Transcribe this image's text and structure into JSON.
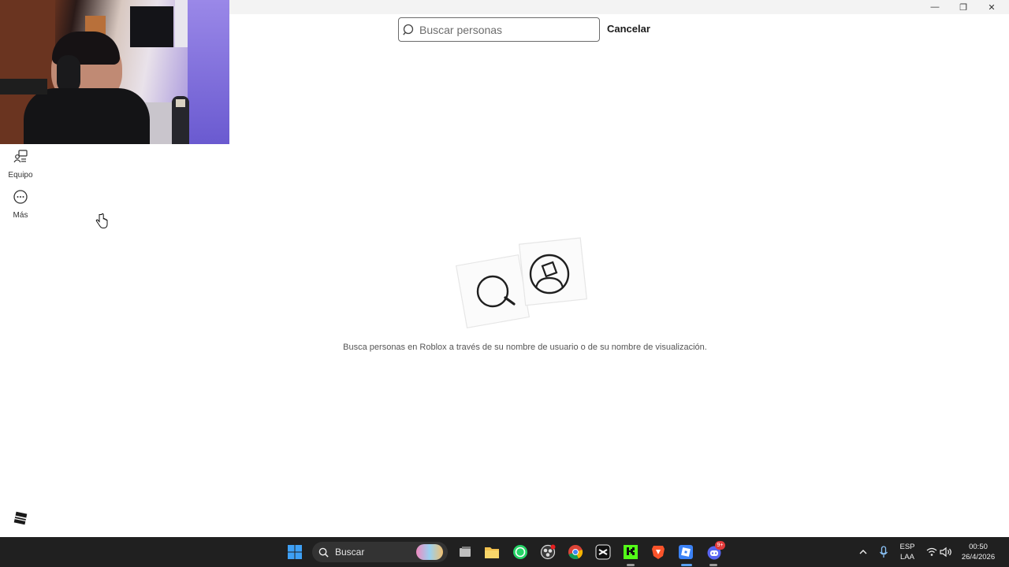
{
  "window": {
    "minimize": "—",
    "maximize": "❐",
    "close": "✕"
  },
  "search": {
    "placeholder": "Buscar personas",
    "value": "",
    "cancel_label": "Cancelar"
  },
  "sidebar": {
    "items": [
      {
        "label": "Equipo",
        "icon": "avatar-shop-icon"
      },
      {
        "label": "Más",
        "icon": "more-icon"
      }
    ]
  },
  "empty_state": {
    "description": "Busca personas en Roblox a través de su nombre de usuario o de su nombre de visualización."
  },
  "taskbar": {
    "search_label": "Buscar",
    "apps": [
      "start-icon",
      "search-icon",
      "task-view-icon",
      "file-explorer-icon",
      "whatsapp-icon",
      "obs-icon",
      "chrome-icon",
      "capcut-icon",
      "kick-icon",
      "brave-icon",
      "roblox-icon",
      "discord-icon"
    ],
    "discord_badge": "9+",
    "language": "ESP",
    "keyboard": "LAA",
    "time": "00:50",
    "date": "26/4/2026"
  }
}
